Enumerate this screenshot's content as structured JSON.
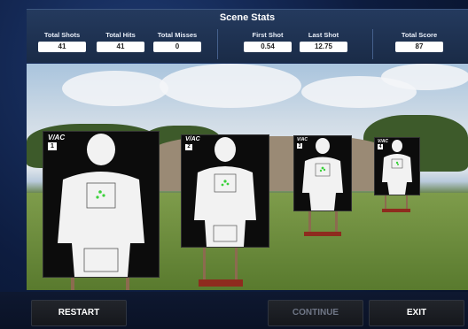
{
  "header": {
    "title": "Scene Stats"
  },
  "stats": [
    {
      "label": "Total Shots",
      "value": "41"
    },
    {
      "label": "Total Hits",
      "value": "41"
    },
    {
      "label": "Total Misses",
      "value": "0"
    },
    {
      "label": "First Shot",
      "value": "0.54"
    },
    {
      "label": "Last Shot",
      "value": "12.75"
    },
    {
      "label": "Total Score",
      "value": "87"
    }
  ],
  "targets": [
    {
      "brand": "V/AC",
      "number": "1"
    },
    {
      "brand": "V/AC",
      "number": "2"
    },
    {
      "brand": "V/AC",
      "number": "3"
    },
    {
      "brand": "V/AC",
      "number": "4"
    }
  ],
  "buttons": {
    "restart": "RESTART",
    "continue": "CONTINUE",
    "exit": "EXIT"
  },
  "colors": {
    "hit_marker": "#3ad13a",
    "stand_base": "#8e2b1e"
  }
}
